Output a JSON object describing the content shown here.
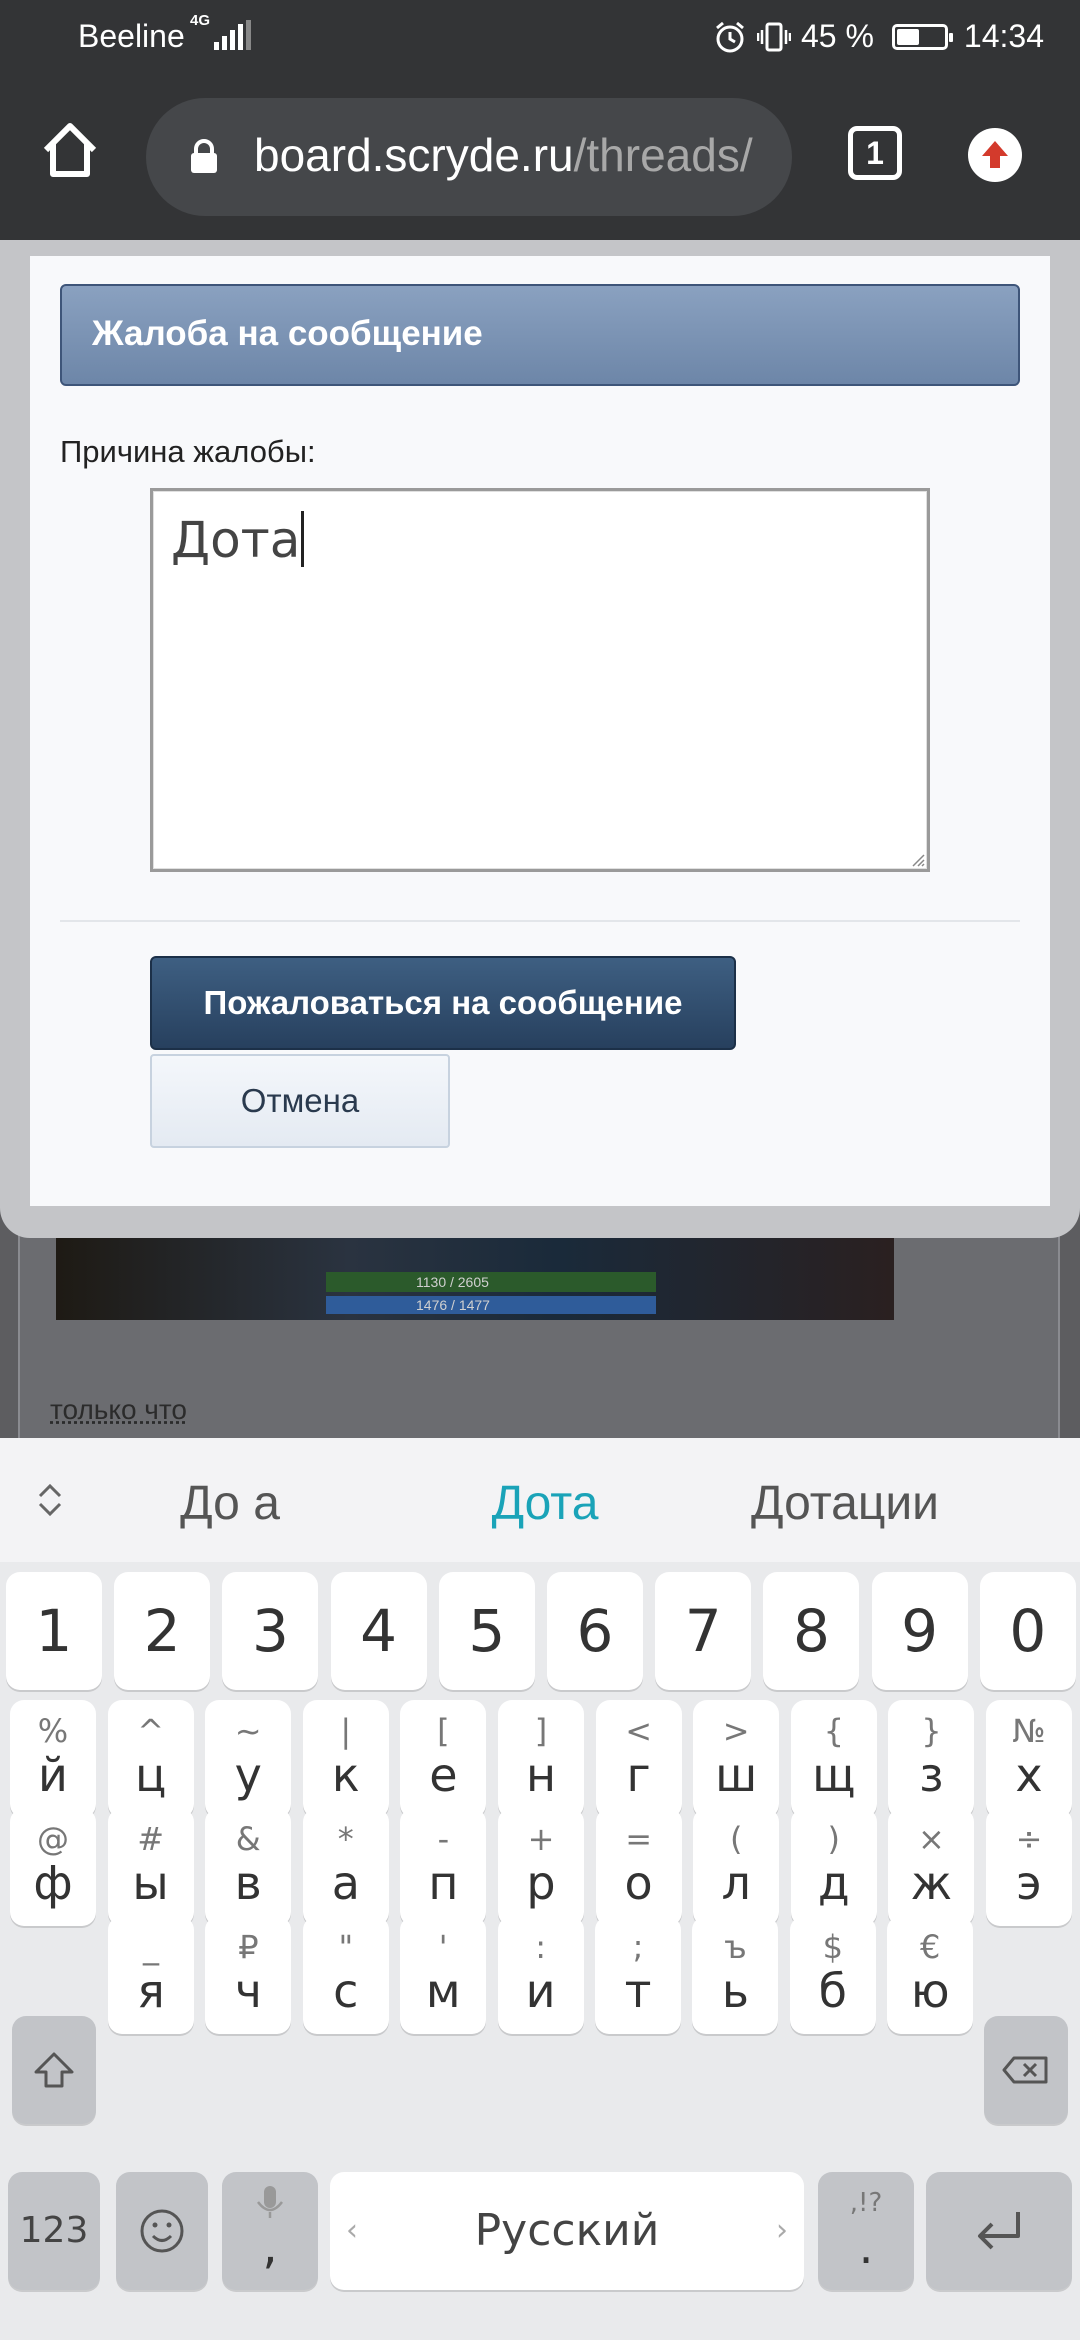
{
  "status_bar": {
    "carrier": "Beeline",
    "network_type": "4G",
    "battery_percent": "45 %",
    "battery_level": 0.45,
    "time": "14:34"
  },
  "browser": {
    "url_domain": "board.scryde.ru",
    "url_path": "/threads/",
    "tab_count": "1"
  },
  "modal": {
    "title": "Жалоба на сообщение",
    "reason_label": "Причина жалобы:",
    "reason_value": "Дота",
    "submit_label": "Пожаловаться на сообщение",
    "cancel_label": "Отмена"
  },
  "page": {
    "timestamp_link": "только что",
    "game_stat_1": "1130 / 2605",
    "game_stat_2": "1476 / 1477"
  },
  "keyboard": {
    "suggestions": [
      "До а",
      "Дота",
      "Дотации"
    ],
    "digits": [
      "1",
      "2",
      "3",
      "4",
      "5",
      "6",
      "7",
      "8",
      "9",
      "0"
    ],
    "row1": [
      {
        "main": "й",
        "sub": "%"
      },
      {
        "main": "ц",
        "sub": "^"
      },
      {
        "main": "у",
        "sub": "~"
      },
      {
        "main": "к",
        "sub": "|"
      },
      {
        "main": "е",
        "sub": "["
      },
      {
        "main": "н",
        "sub": "]"
      },
      {
        "main": "г",
        "sub": "<"
      },
      {
        "main": "ш",
        "sub": ">"
      },
      {
        "main": "щ",
        "sub": "{"
      },
      {
        "main": "з",
        "sub": "}"
      },
      {
        "main": "х",
        "sub": "№"
      }
    ],
    "row2": [
      {
        "main": "ф",
        "sub": "@"
      },
      {
        "main": "ы",
        "sub": "#"
      },
      {
        "main": "в",
        "sub": "&"
      },
      {
        "main": "а",
        "sub": "*"
      },
      {
        "main": "п",
        "sub": "-"
      },
      {
        "main": "р",
        "sub": "+"
      },
      {
        "main": "о",
        "sub": "="
      },
      {
        "main": "л",
        "sub": "("
      },
      {
        "main": "д",
        "sub": ")"
      },
      {
        "main": "ж",
        "sub": "×"
      },
      {
        "main": "э",
        "sub": "÷"
      }
    ],
    "row3": [
      {
        "main": "я",
        "sub": "_"
      },
      {
        "main": "ч",
        "sub": "₽"
      },
      {
        "main": "с",
        "sub": "\""
      },
      {
        "main": "м",
        "sub": "'"
      },
      {
        "main": "и",
        "sub": ":"
      },
      {
        "main": "т",
        "sub": ";"
      },
      {
        "main": "ь",
        "sub": "ъ"
      },
      {
        "main": "б",
        "sub": "$"
      },
      {
        "main": "ю",
        "sub": "€"
      }
    ],
    "mode_key": "123",
    "comma_key": ",",
    "space_label": "Русский",
    "period_sub": ",!?",
    "period_key": "."
  }
}
